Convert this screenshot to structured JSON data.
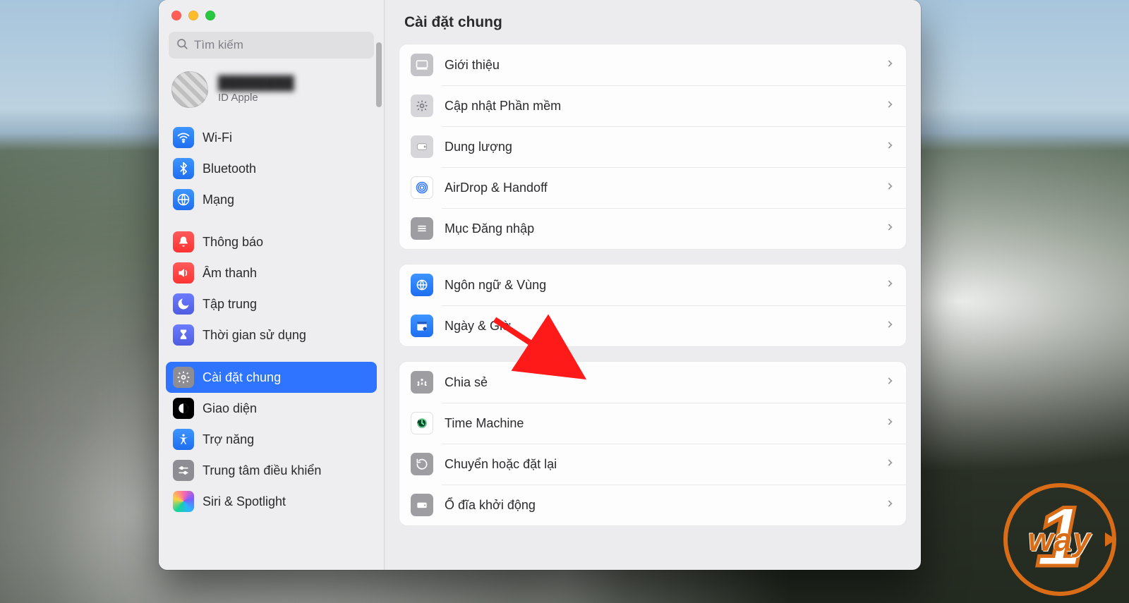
{
  "search": {
    "placeholder": "Tìm kiếm"
  },
  "account": {
    "name": "████████",
    "subtitle": "ID Apple"
  },
  "sidebar": {
    "wifi": "Wi-Fi",
    "bluetooth": "Bluetooth",
    "network": "Mạng",
    "notifications": "Thông báo",
    "sound": "Âm thanh",
    "focus": "Tập trung",
    "screentime": "Thời gian sử dụng",
    "general": "Cài đặt chung",
    "appearance": "Giao diện",
    "accessibility": "Trợ năng",
    "controlcenter": "Trung tâm điều khiển",
    "siri": "Siri & Spotlight"
  },
  "content": {
    "title": "Cài đặt chung",
    "about": "Giới thiệu",
    "softwareupdate": "Cập nhật Phần mềm",
    "storage": "Dung lượng",
    "airdrop": "AirDrop & Handoff",
    "loginitems": "Mục Đăng nhập",
    "language": "Ngôn ngữ & Vùng",
    "datetime": "Ngày & Giờ",
    "sharing": "Chia sẻ",
    "timemachine": "Time Machine",
    "transfer": "Chuyển hoặc đặt lại",
    "startup": "Ổ đĩa khởi động"
  },
  "watermark": {
    "text": "way"
  }
}
